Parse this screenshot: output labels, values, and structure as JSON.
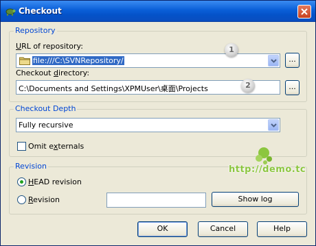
{
  "window": {
    "title": "Checkout",
    "close_icon": "close-icon"
  },
  "repository": {
    "group_title": "Repository",
    "url_label_prefix": "U",
    "url_label_rest": "RL of repository:",
    "url_value": "file:///C:\\SVNRepository/",
    "browse_label": "...",
    "checkout_dir_label_prefix": "Checkout ",
    "checkout_dir_label_u": "d",
    "checkout_dir_label_rest": "irectory:",
    "checkout_dir_value": "C:\\Documents and Settings\\XPMUser\\桌面\\Projects",
    "browse2_label": "..."
  },
  "depth": {
    "group_title": "Checkout Depth",
    "selected": "Fully recursive",
    "omit_label_prefix": "Omit e",
    "omit_label_u": "x",
    "omit_label_rest": "ternals",
    "omit_checked": false
  },
  "revision": {
    "group_title": "Revision",
    "head_label_u": "H",
    "head_label_rest": "EAD revision",
    "rev_label_u": "R",
    "rev_label_rest": "evision",
    "rev_value": "",
    "showlog_label": "Show log",
    "selected": "head"
  },
  "buttons": {
    "ok": "OK",
    "cancel": "Cancel",
    "help": "Help"
  },
  "annotations": {
    "callout1": "1",
    "callout2": "2",
    "watermark": "http://demo.tc"
  },
  "colors": {
    "accent": "#0046d5",
    "titlebar": "#0a5fd8",
    "selection": "#316ac5"
  }
}
